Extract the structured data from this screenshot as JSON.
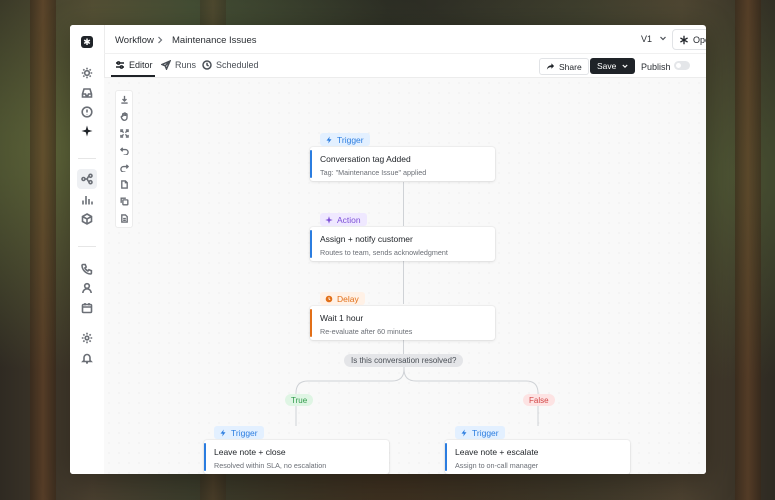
{
  "breadcrumb": {
    "root": "Workflow",
    "current": "Maintenance Issues"
  },
  "header": {
    "version": "V1",
    "operator": "Operator"
  },
  "tabs": [
    {
      "label": "Editor",
      "icon": "sliders-icon"
    },
    {
      "label": "Runs",
      "icon": "send-icon"
    },
    {
      "label": "Scheduled",
      "icon": "clock-icon"
    }
  ],
  "actions": {
    "share": "Share",
    "save": "Save",
    "publish": "Publish"
  },
  "flow": {
    "node1": {
      "badge": "Trigger",
      "title": "Conversation tag Added",
      "desc": "Tag: \"Maintenance Issue\" applied"
    },
    "node2": {
      "badge": "Action",
      "title": "Assign + notify customer",
      "desc": "Routes to team, sends acknowledgment"
    },
    "node3": {
      "badge": "Delay",
      "title": "Wait 1 hour",
      "desc": "Re-evaluate after 60 minutes"
    },
    "condition": "Is this conversation resolved?",
    "branch_true": "True",
    "branch_false": "False",
    "node4": {
      "badge": "Trigger",
      "title": "Leave note + close",
      "desc": "Resolved within SLA, no escalation"
    },
    "node5": {
      "badge": "Trigger",
      "title": "Leave note + escalate",
      "desc": "Assign to on-call manager"
    }
  },
  "colors": {
    "trigger": "#2b7de0",
    "action": "#7c4fd6",
    "delay": "#e26f18",
    "true": "#2e9a48",
    "false": "#d24545"
  }
}
